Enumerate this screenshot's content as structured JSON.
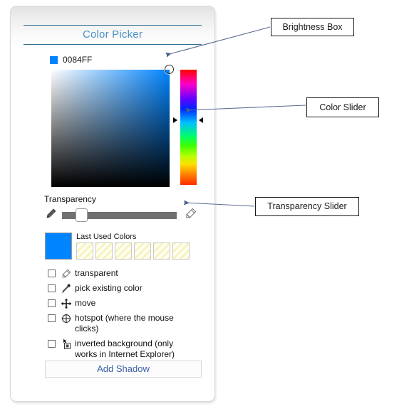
{
  "panel": {
    "title": "Color Picker",
    "hex": {
      "swatch_color": "#0084FF",
      "value": "0084FF"
    },
    "brightness_box": {
      "name": "Brightness Box",
      "base_color": "#0084FF"
    },
    "color_slider": {
      "name": "Color Slider"
    },
    "transparency": {
      "label": "Transparency",
      "left_icon": "solid-pencil-icon",
      "right_icon": "outline-pencil-icon"
    },
    "last_used": {
      "label": "Last Used Colors",
      "current_color": "#0084FF",
      "swatch_count": 6
    },
    "options": [
      {
        "label": "transparent",
        "icon": "outline-pencil-icon",
        "checked": false
      },
      {
        "label": "pick existing color",
        "icon": "eyedropper-icon",
        "checked": false
      },
      {
        "label": "move",
        "icon": "move-arrows-icon",
        "checked": false
      },
      {
        "label": "hotspot (where the mouse clicks)",
        "icon": "crosshair-circle-icon",
        "checked": false
      },
      {
        "label": "inverted background (only works in Internet Explorer)",
        "icon": "cursor-box-icon",
        "checked": false
      }
    ],
    "add_shadow_label": "Add Shadow"
  },
  "annotations": [
    {
      "label": "Brightness Box"
    },
    {
      "label": "Color Slider"
    },
    {
      "label": "Transparency Slider"
    }
  ],
  "colors": {
    "accent": "#0084FF",
    "title_text": "#4a90c4",
    "title_rule": "#2b6f92",
    "button_text": "#3a5fa8",
    "annotation_arrow": "#5a6a92"
  }
}
